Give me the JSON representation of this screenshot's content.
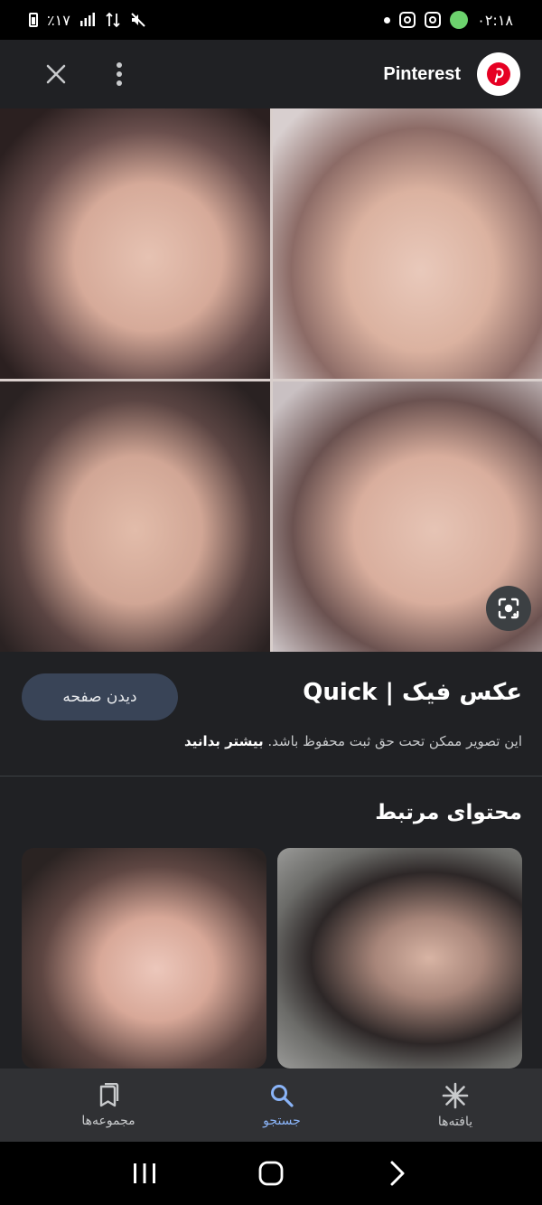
{
  "status_bar": {
    "time": "۰۲:۱۸",
    "battery": "٪۱۷",
    "icons": [
      "dot-icon",
      "instagram-icon",
      "instagram-icon",
      "app-icon",
      "mute-icon",
      "network-icon",
      "signal-icon",
      "battery-icon"
    ]
  },
  "app_bar": {
    "brand_name": "Pinterest",
    "logo_icon": "pinterest-logo",
    "more_icon": "more-vert-icon",
    "close_icon": "close-icon"
  },
  "main_image": {
    "lens_icon": "google-lens-icon"
  },
  "info": {
    "visit_label": "دیدن صفحه",
    "title": "عکس فیک | Quick",
    "copyright_text": "این تصویر ممکن تحت حق ثبت محفوظ باشد.",
    "learn_more": "بیشتر بدانید"
  },
  "related": {
    "title": "محتوای مرتبط"
  },
  "bottom_nav": {
    "items": [
      {
        "label": "مجموعه‌ها",
        "icon": "collections-icon"
      },
      {
        "label": "جستجو",
        "icon": "search-icon"
      },
      {
        "label": "یافته‌ها",
        "icon": "discover-icon"
      }
    ],
    "active": 1,
    "active_color": "#8ab4f8"
  },
  "colors": {
    "background": "#202124",
    "button_bg": "#394457",
    "pinterest_red": "#e60023"
  }
}
